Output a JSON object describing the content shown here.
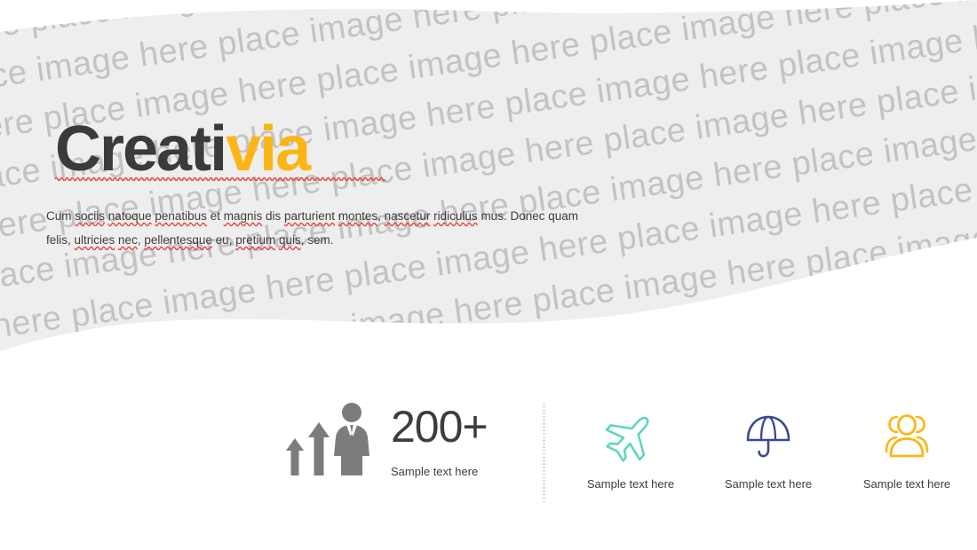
{
  "slide": {
    "background_color": "#ffffff",
    "band_color": "#eeeeee",
    "watermark_text": "place image here",
    "watermark_color": "#c3c3c3"
  },
  "headline": {
    "part_dark": "Creati",
    "part_accent": "via",
    "dark_color": "#3b3b3b",
    "accent_color": "#fbb615",
    "spellcheck_underline_color": "#e8413a"
  },
  "lead": {
    "line1_a": "Cum ",
    "line1_sociis": "sociis",
    "line1_b": " ",
    "line1_natoque": "natoque",
    "line1_c": " ",
    "line1_penatibus": "penatibus",
    "line1_d": " et ",
    "line1_magnis": "magnis",
    "line1_e": " dis ",
    "line1_parturient": "parturient",
    "line1_f": " ",
    "line1_montes": "montes",
    "line1_g": ", ",
    "line1_nascetur": "nascetur",
    "line1_h": " ",
    "line1_ridiculus": "ridiculus",
    "line1_i": " mus. Donec quam felis, ",
    "line2_ultricies": "ultricies",
    "line2_a": " ",
    "line2_nec": "nec",
    "line2_b": ", ",
    "line2_pellentesque": "pellentesque",
    "line2_c": " eu, ",
    "line2_pretium": "pretium",
    "line2_d": " ",
    "line2_quis": "quis",
    "line2_e": ", sem.",
    "full_text": "Cum sociis natoque penatibus et magnis dis parturient montes, nascetur ridiculus mus. Donec quam felis, ultricies nec, pellentesque eu, pretium quis, sem."
  },
  "stats": [
    {
      "id": "featured",
      "icon": "businessman-growth-arrows-icon",
      "icon_color": "#7c7c7c",
      "number": "200+",
      "caption": "Sample text here"
    },
    {
      "id": "plane",
      "icon": "airplane-icon",
      "icon_color": "#5fd6c0",
      "caption": "Sample text here"
    },
    {
      "id": "umbrella",
      "icon": "umbrella-icon",
      "icon_color": "#3b4a8c",
      "caption": "Sample text here"
    },
    {
      "id": "people",
      "icon": "people-group-icon",
      "icon_color": "#fbb615",
      "caption": "Sample text here"
    }
  ],
  "divider": {
    "name": "vertical-dotted-divider",
    "color": "#d8d8d8"
  }
}
